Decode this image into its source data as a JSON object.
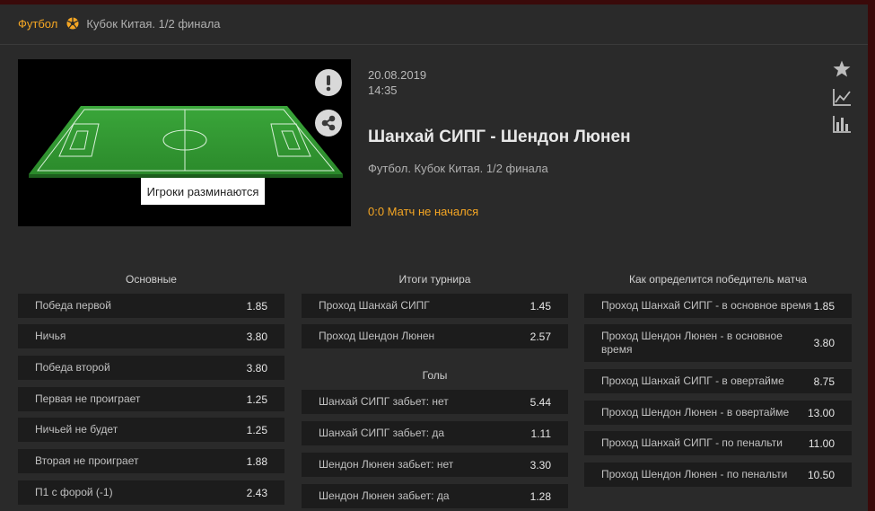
{
  "breadcrumb": {
    "sport": "Футбол",
    "tournament": "Кубок Китая. 1/2 финала"
  },
  "video": {
    "overlay_label": "Игроки разминаются"
  },
  "match": {
    "date": "20.08.2019",
    "time": "14:35",
    "title": "Шанхай СИПГ - Шендон Люнен",
    "subtitle": "Футбол. Кубок Китая. 1/2 финала",
    "status": "0:0 Матч не начался"
  },
  "columns": {
    "main": {
      "title": "Основные",
      "rows": [
        {
          "label": "Победа первой",
          "value": "1.85"
        },
        {
          "label": "Ничья",
          "value": "3.80"
        },
        {
          "label": "Победа второй",
          "value": "3.80"
        },
        {
          "label": "Первая не проиграет",
          "value": "1.25"
        },
        {
          "label": "Ничьей не будет",
          "value": "1.25"
        },
        {
          "label": "Вторая не проиграет",
          "value": "1.88"
        },
        {
          "label": "П1 с форой (-1)",
          "value": "2.43"
        }
      ]
    },
    "tournament": {
      "title": "Итоги турнира",
      "rows": [
        {
          "label": "Проход Шанхай СИПГ",
          "value": "1.45"
        },
        {
          "label": "Проход Шендон Люнен",
          "value": "2.57"
        }
      ]
    },
    "goals": {
      "title": "Голы",
      "rows": [
        {
          "label": "Шанхай СИПГ забьет: нет",
          "value": "5.44"
        },
        {
          "label": "Шанхай СИПГ забьет: да",
          "value": "1.11"
        },
        {
          "label": "Шендон Люнен забьет: нет",
          "value": "3.30"
        },
        {
          "label": "Шендон Люнен забьет: да",
          "value": "1.28"
        }
      ]
    },
    "winner": {
      "title": "Как определится победитель матча",
      "rows": [
        {
          "label": "Проход Шанхай СИПГ - в основное время",
          "value": "1.85"
        },
        {
          "label": "Проход Шендон Люнен - в основное время",
          "value": "3.80"
        },
        {
          "label": "Проход Шанхай СИПГ - в овертайме",
          "value": "8.75"
        },
        {
          "label": "Проход Шендон Люнен - в овертайме",
          "value": "13.00"
        },
        {
          "label": "Проход Шанхай СИПГ - по пенальти",
          "value": "11.00"
        },
        {
          "label": "Проход Шендон Люнен - по пенальти",
          "value": "10.50"
        }
      ]
    }
  },
  "icons": {
    "sport": "football-icon",
    "alert": "exclamation-icon",
    "share": "share-icon",
    "favorite": "star-icon",
    "line_chart": "line-chart-icon",
    "bar_chart": "bar-chart-icon"
  },
  "colors": {
    "accent": "#f5a623",
    "row_bg": "#1c1c1c",
    "page_bg": "#2a2a2a"
  }
}
